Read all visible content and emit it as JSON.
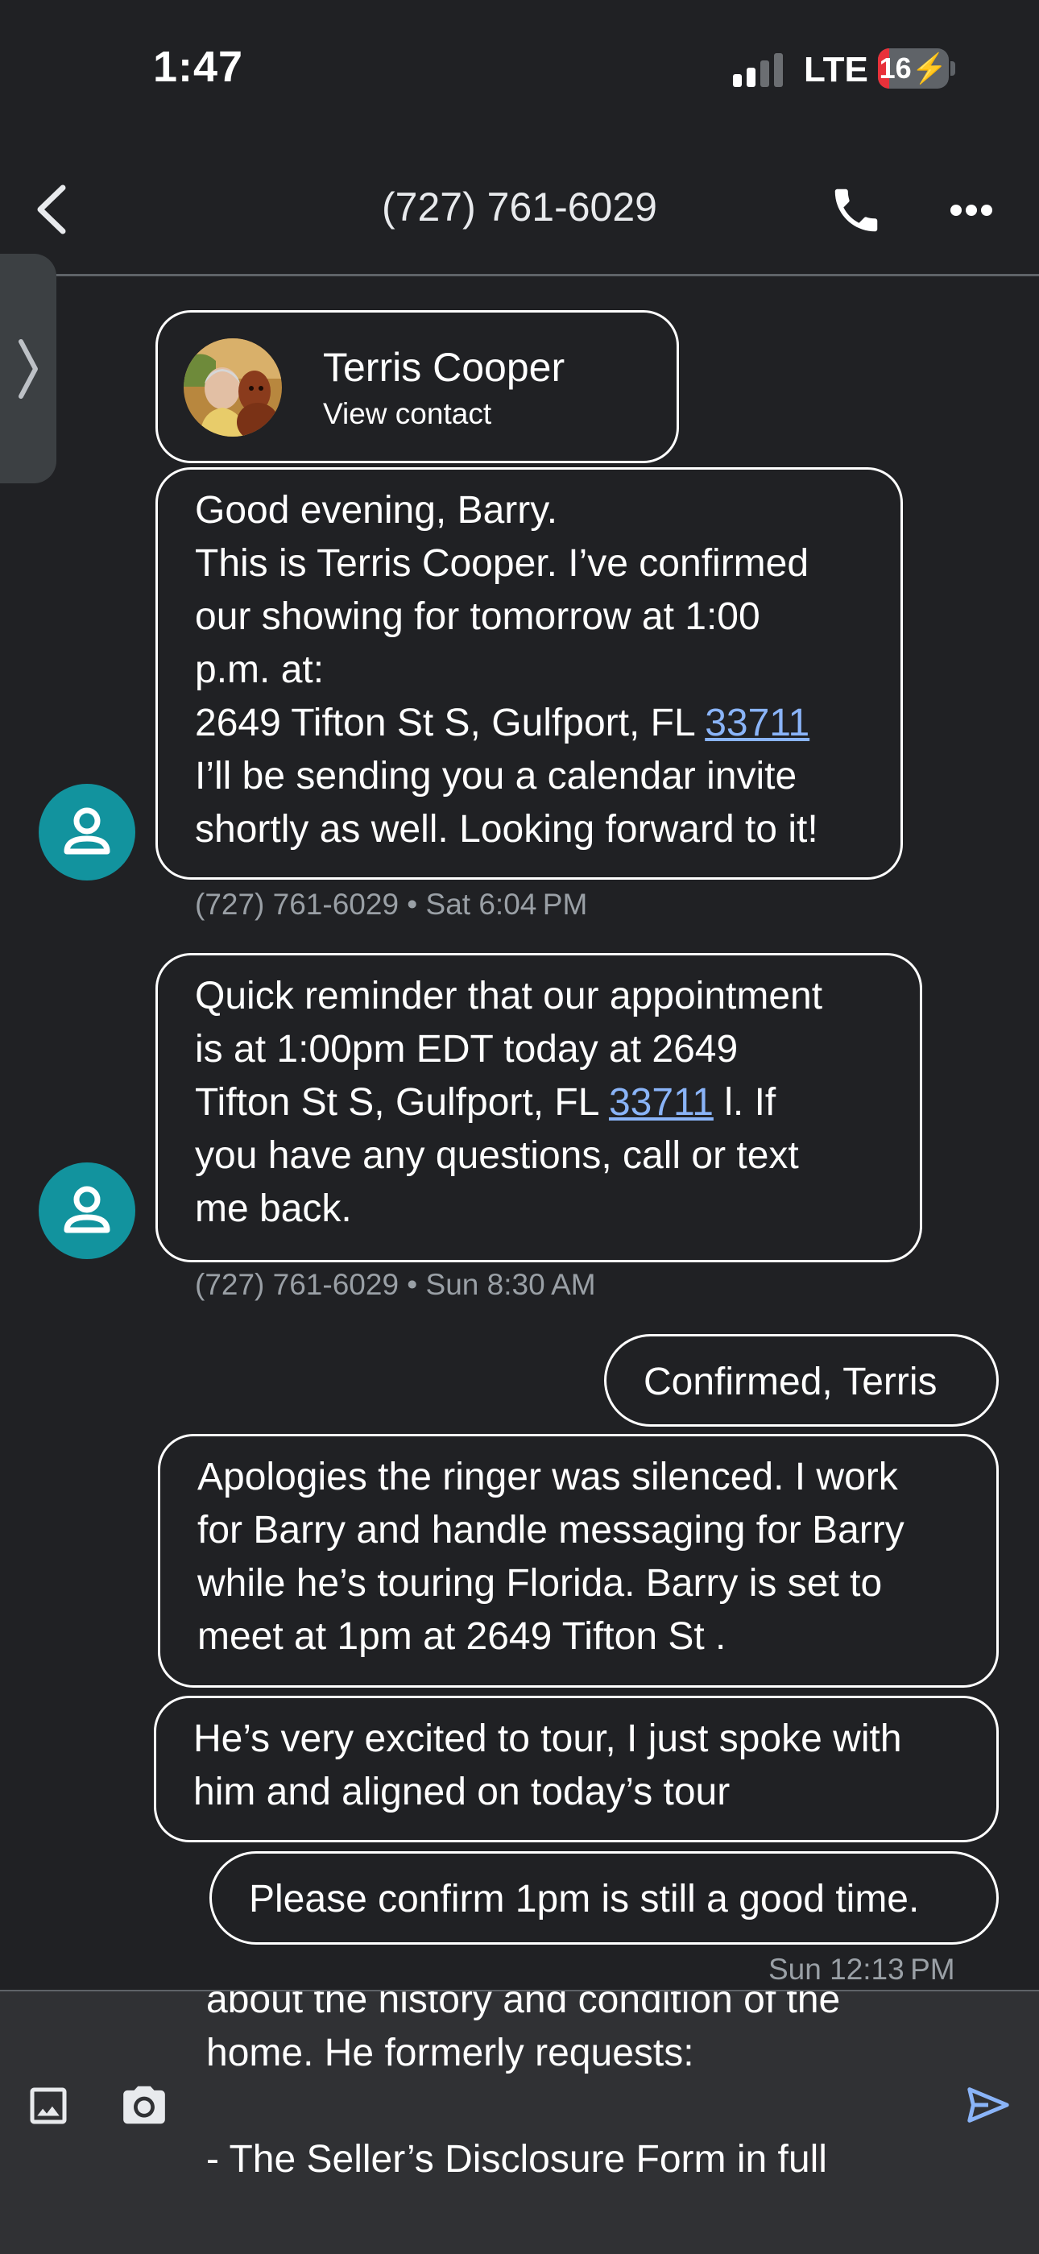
{
  "status_bar": {
    "time": "1:47",
    "network": "LTE",
    "battery": "16",
    "battery_level": 0.16,
    "battery_color": "#e8313a",
    "charging": true
  },
  "header": {
    "title": "(727) 761-6029",
    "back_icon": "chevron-left-icon",
    "call_icon": "phone-icon",
    "more_icon": "more-horizontal-icon"
  },
  "contact_card": {
    "name": "Terris Cooper",
    "link": "View contact"
  },
  "messages": [
    {
      "direction": "incoming",
      "lines": [
        {
          "text": "Good evening, Barry."
        },
        {
          "text": "This is Terris Cooper. I’ve confirmed"
        },
        {
          "text": "our showing for tomorrow at 1:00"
        },
        {
          "text": "p.m. at:"
        },
        {
          "pre": "2649 Tifton St S, Gulfport, FL ",
          "link": "33711",
          "post": ""
        },
        {
          "text": "I’ll be sending you a calendar invite"
        },
        {
          "text": "shortly as well. Looking forward to it!"
        }
      ],
      "meta": "(727) 761-6029 • Sat 6:04 PM"
    },
    {
      "direction": "incoming",
      "lines": [
        {
          "text": "Quick reminder that our appointment"
        },
        {
          "text": "is at 1:00pm EDT today at 2649"
        },
        {
          "pre": "Tifton St S, Gulfport, FL ",
          "link": "33711",
          "post": " l. If"
        },
        {
          "text": "you have any questions, call or text"
        },
        {
          "text": "me back."
        }
      ],
      "meta": "(727) 761-6029 • Sun 8:30 AM"
    },
    {
      "direction": "outgoing",
      "lines": [
        {
          "text": "Confirmed, Terris"
        }
      ]
    },
    {
      "direction": "outgoing",
      "lines": [
        {
          "text": "Apologies the ringer was silenced. I work"
        },
        {
          "text": "for Barry and handle messaging for Barry"
        },
        {
          "text": "while he’s touring Florida. Barry is set to"
        },
        {
          "text": "meet at 1pm at 2649 Tifton St ."
        }
      ]
    },
    {
      "direction": "outgoing",
      "lines": [
        {
          "text": "He’s very excited to tour, I just spoke with"
        },
        {
          "text": "him and aligned on today’s tour"
        }
      ]
    },
    {
      "direction": "outgoing",
      "lines": [
        {
          "text": "Please confirm 1pm is still a good time."
        }
      ],
      "meta": "Sun 12:13 PM"
    }
  ],
  "compose": {
    "lines": [
      "about the history and condition of the",
      "home. He formerly requests:",
      "",
      "- The Seller’s Disclosure Form in full"
    ],
    "gallery_icon": "image-icon",
    "camera_icon": "camera-icon",
    "send_icon": "send-icon"
  }
}
